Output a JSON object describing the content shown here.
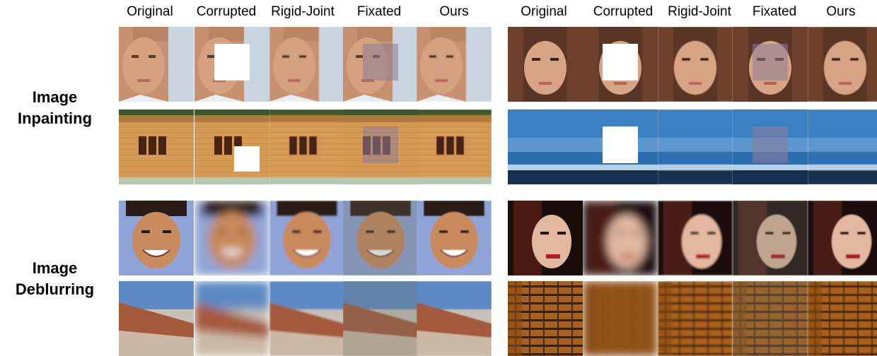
{
  "columns": [
    "Original",
    "Corrupted",
    "Rigid-Joint",
    "Fixated",
    "Ours"
  ],
  "row_groups": [
    {
      "line1": "Image",
      "line2": "Inpainting"
    },
    {
      "line1": "Image",
      "line2": "Deblurring"
    }
  ],
  "panels": [
    {
      "group": "Image Inpainting",
      "side": "left",
      "subject": "face-man",
      "corruption": "mask"
    },
    {
      "group": "Image Inpainting",
      "side": "right",
      "subject": "face-woman",
      "corruption": "mask"
    },
    {
      "group": "Image Inpainting",
      "side": "left",
      "subject": "brick-shed",
      "corruption": "mask"
    },
    {
      "group": "Image Inpainting",
      "side": "right",
      "subject": "sea-sky",
      "corruption": "mask"
    },
    {
      "group": "Image Deblurring",
      "side": "left",
      "subject": "smiling-face",
      "corruption": "blur"
    },
    {
      "group": "Image Deblurring",
      "side": "right",
      "subject": "woman-red-lips",
      "corruption": "blur"
    },
    {
      "group": "Image Deblurring",
      "side": "left",
      "subject": "sand-dune",
      "corruption": "blur"
    },
    {
      "group": "Image Deblurring",
      "side": "right",
      "subject": "brick-wall",
      "corruption": "blur"
    }
  ]
}
